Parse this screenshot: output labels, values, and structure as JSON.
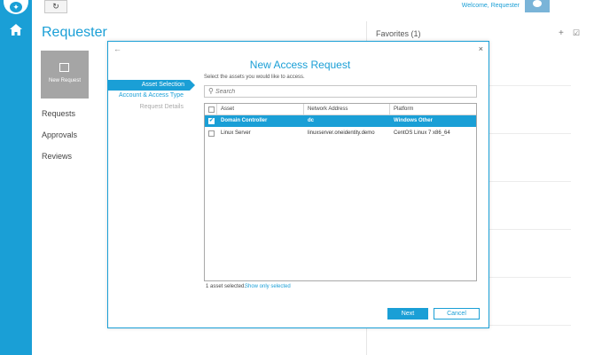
{
  "header": {
    "welcome": "Welcome, Requester",
    "refresh_icon": "refresh-icon",
    "brand_color": "#1a9fd6"
  },
  "app": {
    "title": "Requester",
    "tile_label": "New Request",
    "nav": [
      "Requests",
      "Approvals",
      "Reviews"
    ]
  },
  "favorites": {
    "title": "Favorites (1)",
    "add": "+",
    "select": "☑"
  },
  "dialog": {
    "title": "New Access Request",
    "back": "←",
    "close": "×",
    "steps": [
      "Asset Selection",
      "Account & Access Type",
      "Request Details"
    ],
    "hint": "Select the assets you would like to access.",
    "search_placeholder": "Search",
    "columns": [
      "Asset",
      "Network Address",
      "Platform"
    ],
    "rows": [
      {
        "asset": "Domain Controller",
        "network_address": "dc",
        "platform": "Windows Other",
        "checked": "✔",
        "selected": true
      },
      {
        "asset": "Linux Server",
        "network_address": "linuxserver.oneidentity.demo",
        "platform": "CentOS Linux 7 x86_64",
        "checked": "",
        "selected": false
      }
    ],
    "selected_count": "1 asset selected.",
    "show_only_selected": "Show only selected",
    "next_label": "Next",
    "cancel_label": "Cancel"
  }
}
